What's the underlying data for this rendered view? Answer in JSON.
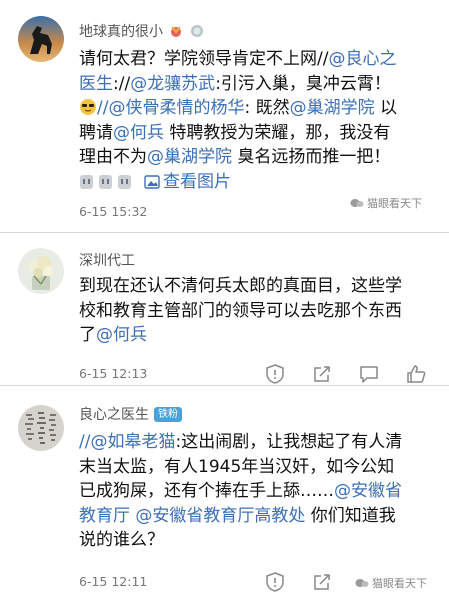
{
  "comments": [
    {
      "username": "地球真的很小",
      "body": {
        "l1_a": "请何太君？学院领导肯定不上网//",
        "l1_m": "@良心之",
        "l2_m": "医生",
        "l2_b": "://",
        "l2_m2": "@龙骧苏武",
        "l2_c": ":引污入巢，臭冲云霄！",
        "l3_a": "//",
        "l3_m": "@侠骨柔情的杨华",
        "l3_b": ": 既然",
        "l3_m2": "@巢湖学院",
        "l3_c": " 以",
        "l4_a": "聘请",
        "l4_m": "@何兵",
        "l4_b": " 特聘教授为荣耀，那，我没有",
        "l5_a": "理由不为",
        "l5_m": "@巢湖学院",
        "l5_b": " 臭名远扬而推一把！",
        "view_images": "查看图片"
      },
      "time": "6-15 15:32"
    },
    {
      "username": "深圳代工",
      "body": {
        "l1": "到现在还认不清何兵太郎的真面目，这些学",
        "l2": "校和教育主管部门的领导可以去吃那个东西",
        "l3_a": "了",
        "l3_m": "@何兵"
      },
      "time": "6-15 12:13"
    },
    {
      "username": "良心之医生",
      "tag": "铁粉",
      "body": {
        "l1_a": "//",
        "l1_m": "@如皋老猫",
        "l1_b": ":这出闹剧，让我想起了有人清",
        "l2": "末当太监，有人1945年当汉奸，如今公知",
        "l3_a": "已成狗屎，还有个捧在手上舔……",
        "l3_m": "@安徽省",
        "l4_m": "教育厅",
        "l4_b": " ",
        "l4_m2": "@安徽省教育厅高教处",
        "l4_c": " 你们知道我",
        "l5": "说的谁么？"
      },
      "time": "6-15 12:11"
    }
  ],
  "watermark": {
    "text1": "猫眼看天下",
    "text2": "猫眼看天下"
  },
  "icons": {
    "report": "shield-alert-icon",
    "share": "share-arrow-icon",
    "comment": "comment-bubble-icon",
    "like": "thumbs-up-icon"
  }
}
